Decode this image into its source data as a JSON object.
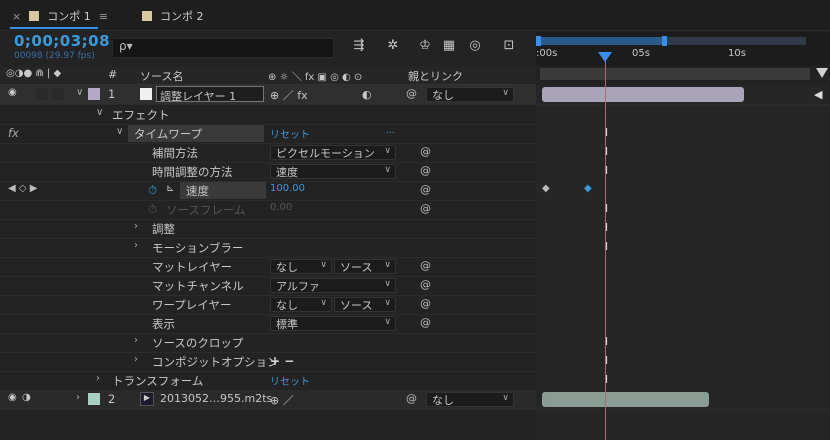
{
  "tabs": [
    {
      "label": "コンポ 1",
      "color": "#d8c8a0"
    },
    {
      "label": "コンポ 2",
      "color": "#d8c8a0"
    }
  ],
  "close_glyph": "×",
  "menu_glyph": "≡",
  "timecode": "0;00;03;08",
  "timecode_sub": "00098 (29.97 fps)",
  "search": {
    "icon": "search-icon",
    "glyph": "ρ▾"
  },
  "ruler": {
    "labels": [
      ":00s",
      "05s",
      "10s"
    ]
  },
  "header": {
    "num": "#",
    "source_name": "ソース名",
    "switches": "⊕ ☼ ＼ fx ▣ ◎ ◐ ⊙",
    "parent": "親とリンク",
    "left_icons": "◎◑● ⋒ | ◆"
  },
  "layers": [
    {
      "num": "1",
      "name": "調整レイヤー 1",
      "color": "#b4aac8",
      "parent": "なし",
      "switch_glyphs": "⊕ ／ fx"
    },
    {
      "num": "2",
      "name": "2013052…955.m2ts",
      "color": "#a8d0c0",
      "parent": "なし",
      "switch_glyphs": "⊕ ／"
    }
  ],
  "effects_label": "エフェクト",
  "timewarp": {
    "name": "タイムワープ",
    "reset": "リセット",
    "dots": "..."
  },
  "props": [
    {
      "key": "interp",
      "label": "補間方法",
      "value": "ピクセルモーション"
    },
    {
      "key": "adjust",
      "label": "時間調整の方法",
      "value": "速度"
    },
    {
      "key": "speed",
      "label": "速度",
      "value": "100.00"
    },
    {
      "key": "srcframe",
      "label": "ソースフレーム",
      "value": "0.00"
    },
    {
      "key": "tune",
      "label": "調整"
    },
    {
      "key": "motionblur",
      "label": "モーションブラー"
    },
    {
      "key": "mattelayer",
      "label": "マットレイヤー",
      "value": "なし",
      "value2": "ソース"
    },
    {
      "key": "mattechannel",
      "label": "マットチャンネル",
      "value": "アルファ"
    },
    {
      "key": "warplayer",
      "label": "ワープレイヤー",
      "value": "なし",
      "value2": "ソース"
    },
    {
      "key": "display",
      "label": "表示",
      "value": "標準"
    },
    {
      "key": "crop",
      "label": "ソースのクロップ"
    },
    {
      "key": "composite",
      "label": "コンポジットオプション",
      "value": "+ −"
    }
  ],
  "transform": {
    "label": "トランスフォーム",
    "reset": "リセット"
  },
  "colors": {
    "accent": "#3a9bdc",
    "playhead": "#3a8ee6"
  },
  "timeline": {
    "duration_s": 12,
    "playhead_s": 3.27,
    "layer1_bar_end_s": 10.5,
    "layer2_bar_end_s": 8.7
  }
}
